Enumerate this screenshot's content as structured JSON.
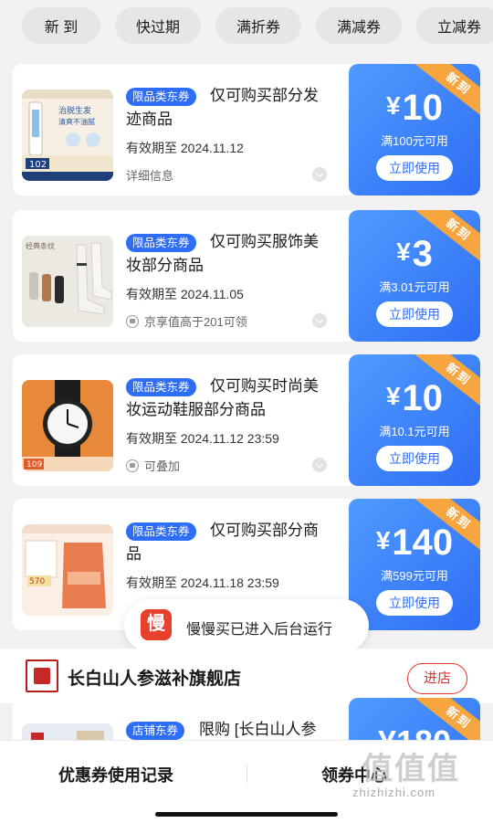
{
  "filter_tabs": [
    {
      "label": "新 到"
    },
    {
      "label": "快过期"
    },
    {
      "label": "满折券"
    },
    {
      "label": "满减券"
    },
    {
      "label": "立减券"
    }
  ],
  "coupons": [
    {
      "tag": "限品类东券",
      "title": "仅可购买部分发迹商品",
      "expiry": "有效期至 2024.11.12",
      "extra": "详细信息",
      "currency": "¥",
      "amount": "10",
      "condition": "满100元可用",
      "button": "立即使用",
      "badge": "新到",
      "thumb_icon": "hair-product-image"
    },
    {
      "tag": "限品类东券",
      "title": "仅可购买服饰美妆部分商品",
      "expiry": "有效期至 2024.11.05",
      "extra": "京享值高于201可领",
      "currency": "¥",
      "amount": "3",
      "condition": "满3.01元可用",
      "button": "立即使用",
      "badge": "新到",
      "thumb_icon": "socks-product-image",
      "thumb_text": "经典条纹"
    },
    {
      "tag": "限品类东券",
      "title": "仅可购买时尚美妆运动鞋服部分商品",
      "expiry": "有效期至 2024.11.12 23:59",
      "extra": "可叠加",
      "currency": "¥",
      "amount": "10",
      "condition": "满10.1元可用",
      "button": "立即使用",
      "badge": "新到",
      "thumb_icon": "watch-product-image"
    },
    {
      "tag": "限品类东券",
      "title": "仅可购买部分商品",
      "expiry": "有效期至 2024.11.18 23:59",
      "extra": "",
      "currency": "¥",
      "amount": "140",
      "condition": "满599元可用",
      "button": "立即使用",
      "badge": "新到",
      "thumb_icon": "food-product-image"
    }
  ],
  "toast": {
    "icon_text": "慢",
    "text": "慢慢买已进入后台运行"
  },
  "store": {
    "name": "长白山人参滋补旗舰店",
    "enter_label": "进店"
  },
  "partial_coupon": {
    "tag": "店铺东券",
    "title": "限购 [长白山人参",
    "badge": "新到",
    "amount_partial": "¥180"
  },
  "bottom_bar": {
    "left_label": "优惠券使用记录",
    "right_label": "领券中心"
  },
  "watermark": {
    "logo": "值值值",
    "text": "zhizhizhi.com"
  },
  "colors": {
    "accent_blue": "#2f6df5",
    "badge_orange": "#f7a53f",
    "store_red": "#e0332a"
  }
}
